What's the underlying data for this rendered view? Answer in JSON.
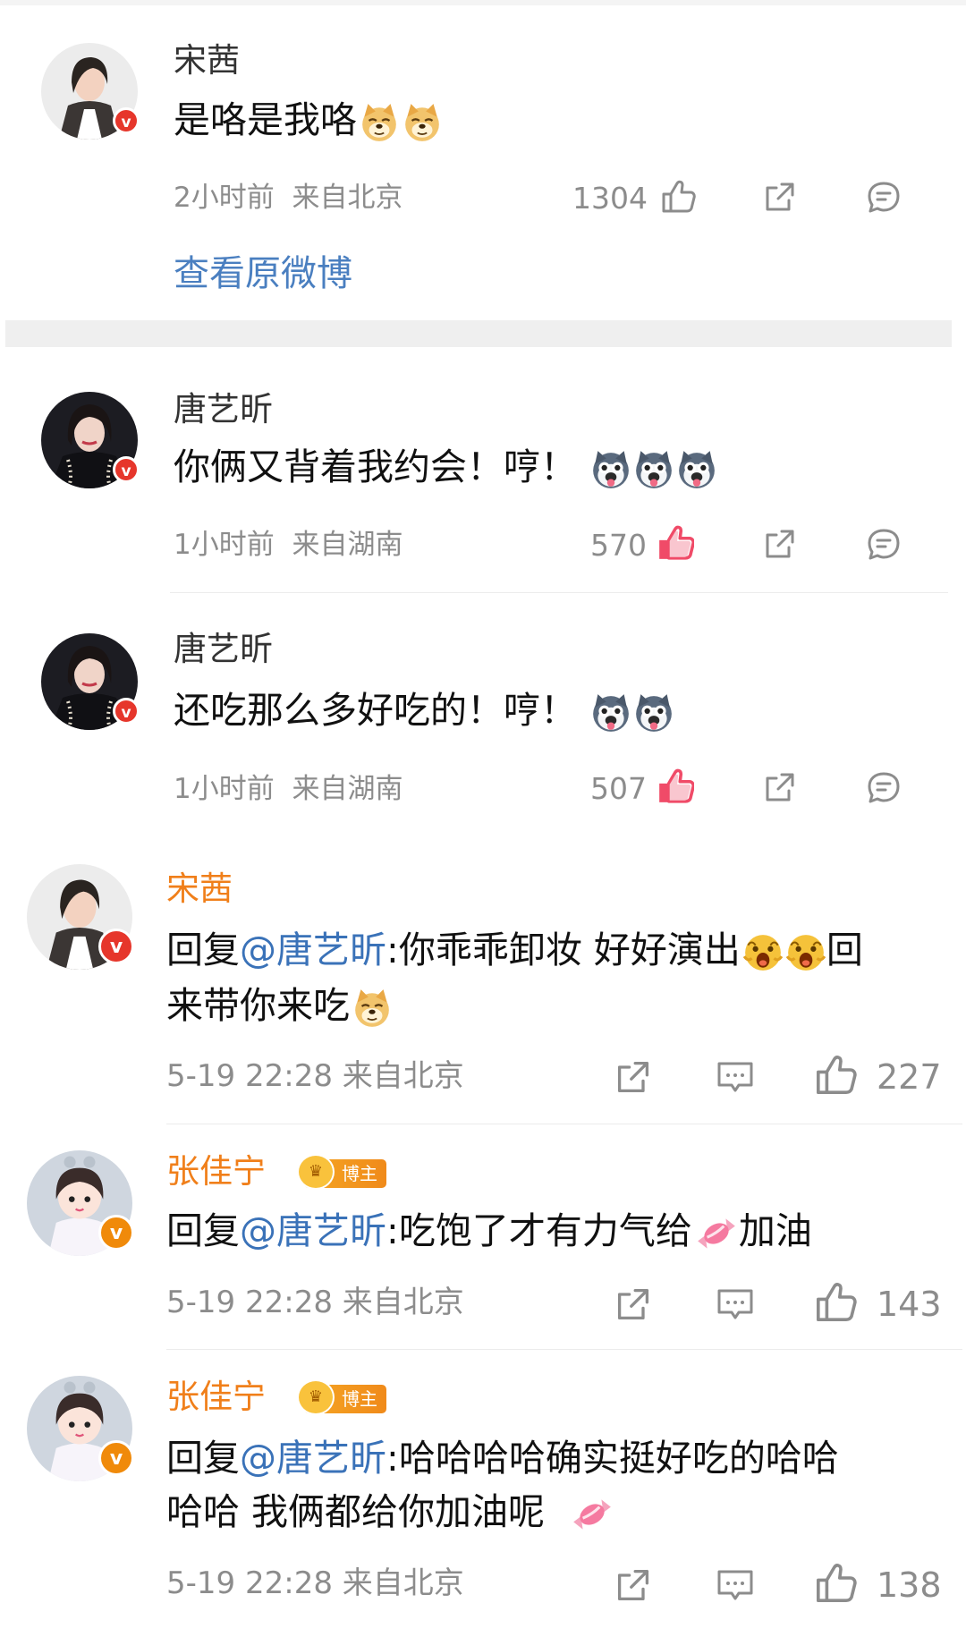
{
  "colors": {
    "name_orange": "#f07f1a",
    "mention_blue": "#3a72b8",
    "link_blue": "#4a7fc0",
    "liked_red": "#f04b68",
    "meta_gray": "#8c8c8c"
  },
  "top_comment": {
    "name": "宋茜",
    "text": "是咯是我咯",
    "emoji": [
      "doge-emoji",
      "doge-emoji"
    ],
    "time": "2小时前",
    "location": "来自北京",
    "likes": "1304",
    "view_original": "查看原微博"
  },
  "replies_top": [
    {
      "name": "唐艺昕",
      "text": "你俩又背着我约会！哼！",
      "emoji": [
        "husky-emoji",
        "husky-emoji",
        "husky-emoji"
      ],
      "time": "1小时前",
      "location": "来自湖南",
      "likes": "570",
      "liked": true
    },
    {
      "name": "唐艺昕",
      "text": "还吃那么多好吃的！哼！",
      "emoji": [
        "husky-emoji",
        "husky-emoji"
      ],
      "time": "1小时前",
      "location": "来自湖南",
      "likes": "507",
      "liked": true
    }
  ],
  "replies": [
    {
      "name": "宋茜",
      "prefix": "回复",
      "mention": "@唐艺昕",
      "line1": ":你乖乖卸妆 好好演出",
      "line1_after": "回",
      "line2": "来带你来吃",
      "time": "5-19 22:28 来自北京",
      "likes": "227"
    },
    {
      "name": "张佳宁",
      "badge": "博主",
      "prefix": "回复",
      "mention": "@唐艺昕",
      "line1": ":吃饱了才有力气给",
      "line1_after": "加油",
      "time": "5-19 22:28 来自北京",
      "likes": "143"
    },
    {
      "name": "张佳宁",
      "badge": "博主",
      "prefix": "回复",
      "mention": "@唐艺昕",
      "line1": ":哈哈哈哈确实挺好吃的哈哈",
      "line2": "哈哈 我俩都给你加油呢",
      "time": "5-19 22:28 来自北京",
      "likes": "138"
    }
  ]
}
